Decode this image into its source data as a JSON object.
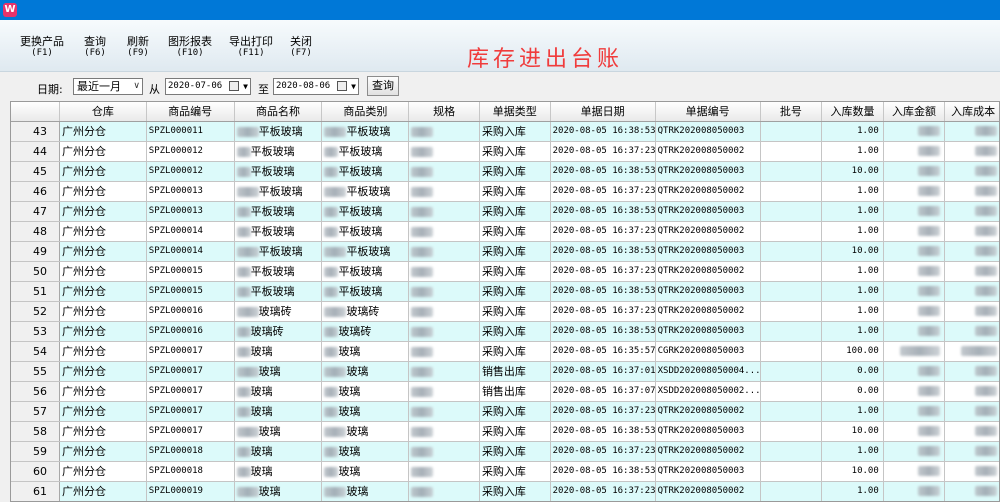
{
  "toolbar": {
    "buttons": [
      {
        "label": "更换产品",
        "key": "(F1)"
      },
      {
        "label": "查询",
        "key": "(F6)"
      },
      {
        "label": "刷新",
        "key": "(F9)"
      },
      {
        "label": "图形报表",
        "key": "(F10)"
      },
      {
        "label": "导出打印",
        "key": "(F11)"
      },
      {
        "label": "关闭",
        "key": "(F7)"
      }
    ],
    "page_title": "库存进出台账"
  },
  "filter": {
    "date_label": "日期:",
    "period_value": "最近一月",
    "from_label": "从",
    "start_date": "2020-07-06",
    "to_label": "至",
    "end_date": "2020-08-06",
    "query_label": "查询"
  },
  "table": {
    "columns": [
      "仓库",
      "商品编号",
      "商品名称",
      "商品类别",
      "规格",
      "单据类型",
      "单据日期",
      "单据编号",
      "批号",
      "入库数量",
      "入库金额",
      "入库成本"
    ],
    "rows": [
      {
        "n": "43",
        "warehouse": "广州分仓",
        "code": "SPZL000011",
        "name": "平板玻璃",
        "category": "平板玻璃",
        "type": "采购入库",
        "date": "2020-08-05 16:38:53",
        "doc": "QTRK202008050003",
        "qty": "1.00"
      },
      {
        "n": "44",
        "warehouse": "广州分仓",
        "code": "SPZL000012",
        "name": "平板玻璃",
        "category": "平板玻璃",
        "type": "采购入库",
        "date": "2020-08-05 16:37:23",
        "doc": "QTRK202008050002",
        "qty": "1.00"
      },
      {
        "n": "45",
        "warehouse": "广州分仓",
        "code": "SPZL000012",
        "name": "平板玻璃",
        "category": "平板玻璃",
        "type": "采购入库",
        "date": "2020-08-05 16:38:53",
        "doc": "QTRK202008050003",
        "qty": "10.00"
      },
      {
        "n": "46",
        "warehouse": "广州分仓",
        "code": "SPZL000013",
        "name": "平板玻璃",
        "category": "平板玻璃",
        "type": "采购入库",
        "date": "2020-08-05 16:37:23",
        "doc": "QTRK202008050002",
        "qty": "1.00"
      },
      {
        "n": "47",
        "warehouse": "广州分仓",
        "code": "SPZL000013",
        "name": "平板玻璃",
        "category": "平板玻璃",
        "type": "采购入库",
        "date": "2020-08-05 16:38:53",
        "doc": "QTRK202008050003",
        "qty": "1.00"
      },
      {
        "n": "48",
        "warehouse": "广州分仓",
        "code": "SPZL000014",
        "name": "平板玻璃",
        "category": "平板玻璃",
        "type": "采购入库",
        "date": "2020-08-05 16:37:23",
        "doc": "QTRK202008050002",
        "qty": "1.00"
      },
      {
        "n": "49",
        "warehouse": "广州分仓",
        "code": "SPZL000014",
        "name": "平板玻璃",
        "category": "平板玻璃",
        "type": "采购入库",
        "date": "2020-08-05 16:38:53",
        "doc": "QTRK202008050003",
        "qty": "10.00"
      },
      {
        "n": "50",
        "warehouse": "广州分仓",
        "code": "SPZL000015",
        "name": "平板玻璃",
        "category": "平板玻璃",
        "type": "采购入库",
        "date": "2020-08-05 16:37:23",
        "doc": "QTRK202008050002",
        "qty": "1.00"
      },
      {
        "n": "51",
        "warehouse": "广州分仓",
        "code": "SPZL000015",
        "name": "平板玻璃",
        "category": "平板玻璃",
        "type": "采购入库",
        "date": "2020-08-05 16:38:53",
        "doc": "QTRK202008050003",
        "qty": "1.00"
      },
      {
        "n": "52",
        "warehouse": "广州分仓",
        "code": "SPZL000016",
        "name": "玻璃砖",
        "category": "玻璃砖",
        "type": "采购入库",
        "date": "2020-08-05 16:37:23",
        "doc": "QTRK202008050002",
        "qty": "1.00"
      },
      {
        "n": "53",
        "warehouse": "广州分仓",
        "code": "SPZL000016",
        "name": "玻璃砖",
        "category": "玻璃砖",
        "type": "采购入库",
        "date": "2020-08-05 16:38:53",
        "doc": "QTRK202008050003",
        "qty": "1.00"
      },
      {
        "n": "54",
        "warehouse": "广州分仓",
        "code": "SPZL000017",
        "name": "玻璃",
        "category": "玻璃",
        "type": "采购入库",
        "date": "2020-08-05 16:35:57",
        "doc": "CGRK202008050003",
        "qty": "100.00"
      },
      {
        "n": "55",
        "warehouse": "广州分仓",
        "code": "SPZL000017",
        "name": "玻璃",
        "category": "玻璃",
        "type": "销售出库",
        "date": "2020-08-05 16:37:01",
        "doc": "XSDD202008050004...",
        "qty": "0.00"
      },
      {
        "n": "56",
        "warehouse": "广州分仓",
        "code": "SPZL000017",
        "name": "玻璃",
        "category": "玻璃",
        "type": "销售出库",
        "date": "2020-08-05 16:37:07",
        "doc": "XSDD202008050002...",
        "qty": "0.00"
      },
      {
        "n": "57",
        "warehouse": "广州分仓",
        "code": "SPZL000017",
        "name": "玻璃",
        "category": "玻璃",
        "type": "采购入库",
        "date": "2020-08-05 16:37:23",
        "doc": "QTRK202008050002",
        "qty": "1.00"
      },
      {
        "n": "58",
        "warehouse": "广州分仓",
        "code": "SPZL000017",
        "name": "玻璃",
        "category": "玻璃",
        "type": "采购入库",
        "date": "2020-08-05 16:38:53",
        "doc": "QTRK202008050003",
        "qty": "10.00"
      },
      {
        "n": "59",
        "warehouse": "广州分仓",
        "code": "SPZL000018",
        "name": "玻璃",
        "category": "玻璃",
        "type": "采购入库",
        "date": "2020-08-05 16:37:23",
        "doc": "QTRK202008050002",
        "qty": "1.00"
      },
      {
        "n": "60",
        "warehouse": "广州分仓",
        "code": "SPZL000018",
        "name": "玻璃",
        "category": "玻璃",
        "type": "采购入库",
        "date": "2020-08-05 16:38:53",
        "doc": "QTRK202008050003",
        "qty": "10.00"
      },
      {
        "n": "61",
        "warehouse": "广州分仓",
        "code": "SPZL000019",
        "name": "玻璃",
        "category": "玻璃",
        "type": "采购入库",
        "date": "2020-08-05 16:37:23",
        "doc": "QTRK202008050002",
        "qty": "1.00"
      }
    ]
  }
}
